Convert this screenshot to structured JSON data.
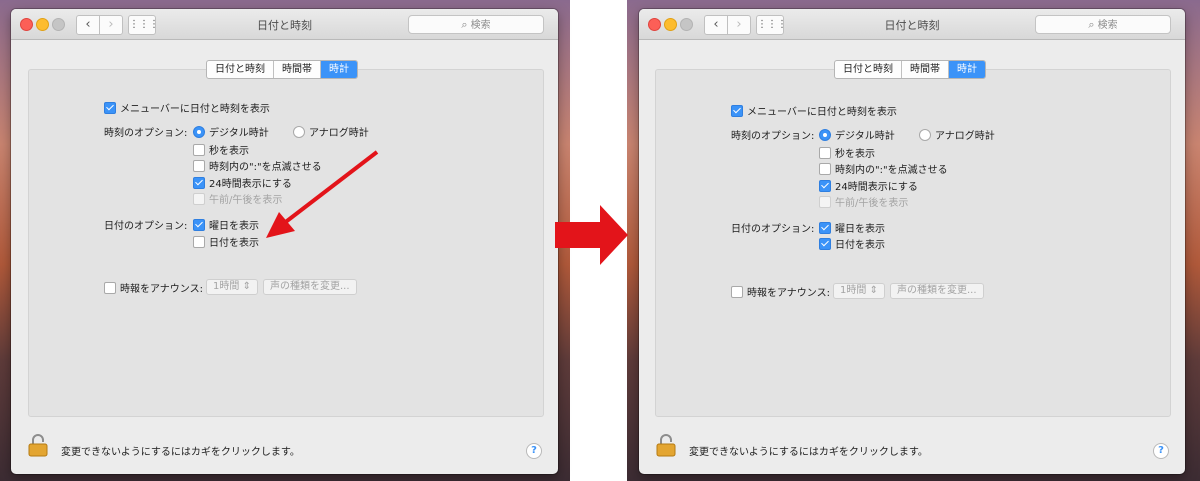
{
  "window": {
    "title": "日付と時刻",
    "search_placeholder": "検索",
    "nav_back": "‹",
    "nav_forward": "›",
    "grid": "⋮⋮⋮"
  },
  "tabs": [
    "日付と時刻",
    "時間帯",
    "時計"
  ],
  "active_tab": "時計",
  "options": {
    "show_in_menubar": "メニューバーに日付と時刻を表示",
    "time_options_label": "時刻のオプション:",
    "digital": "デジタル時計",
    "analog": "アナログ時計",
    "show_seconds": "秒を表示",
    "flash_separators": "時刻内の\":\"を点滅させる",
    "use_24h": "24時間表示にする",
    "show_ampm": "午前/午後を表示",
    "date_options_label": "日付のオプション:",
    "show_weekday": "曜日を表示",
    "show_date": "日付を表示",
    "announce_label": "時報をアナウンス:",
    "announce_interval": "1時間",
    "change_voice": "声の種類を変更..."
  },
  "footer": {
    "lock_text": "変更できないようにするにはカギをクリックします。",
    "help": "?"
  },
  "before_state": {
    "show_date": false
  },
  "after_state": {
    "show_date": true
  },
  "colors": {
    "accent": "#3b93f8",
    "arrow_red": "#e3141a"
  },
  "icons": {
    "search": "magnifier-icon",
    "lock": "padlock-icon",
    "arrow": "red-arrow-icon"
  }
}
